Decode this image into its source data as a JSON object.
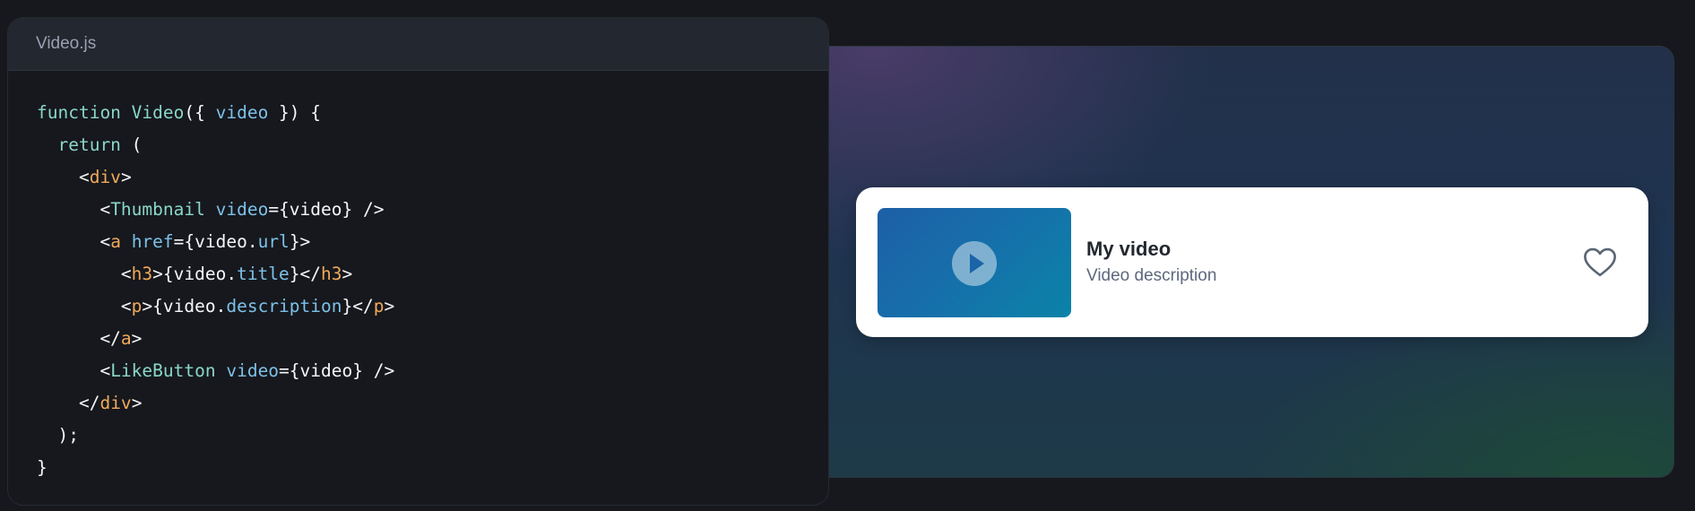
{
  "editor": {
    "filename": "Video.js",
    "lines": [
      [
        [
          "k",
          "function "
        ],
        [
          "k",
          "Video"
        ],
        [
          "p",
          "({ "
        ],
        [
          "v",
          "video"
        ],
        [
          "p",
          " }) {"
        ]
      ],
      [
        [
          "p",
          "  "
        ],
        [
          "k",
          "return"
        ],
        [
          "p",
          " ("
        ]
      ],
      [
        [
          "p",
          "    <"
        ],
        [
          "t",
          "div"
        ],
        [
          "p",
          ">"
        ]
      ],
      [
        [
          "p",
          "      <"
        ],
        [
          "c",
          "Thumbnail"
        ],
        [
          "p",
          " "
        ],
        [
          "v",
          "video"
        ],
        [
          "p",
          "={video} />"
        ]
      ],
      [
        [
          "p",
          "      <"
        ],
        [
          "t",
          "a"
        ],
        [
          "p",
          " "
        ],
        [
          "v",
          "href"
        ],
        [
          "p",
          "={video."
        ],
        [
          "v",
          "url"
        ],
        [
          "p",
          "}>"
        ]
      ],
      [
        [
          "p",
          "        <"
        ],
        [
          "t",
          "h3"
        ],
        [
          "p",
          ">{video."
        ],
        [
          "v",
          "title"
        ],
        [
          "p",
          "}</"
        ],
        [
          "t",
          "h3"
        ],
        [
          "p",
          ">"
        ]
      ],
      [
        [
          "p",
          "        <"
        ],
        [
          "t",
          "p"
        ],
        [
          "p",
          ">{video."
        ],
        [
          "v",
          "description"
        ],
        [
          "p",
          "}</"
        ],
        [
          "t",
          "p"
        ],
        [
          "p",
          ">"
        ]
      ],
      [
        [
          "p",
          "      </"
        ],
        [
          "t",
          "a"
        ],
        [
          "p",
          ">"
        ]
      ],
      [
        [
          "p",
          "      <"
        ],
        [
          "c",
          "LikeButton"
        ],
        [
          "p",
          " "
        ],
        [
          "v",
          "video"
        ],
        [
          "p",
          "={video} />"
        ]
      ],
      [
        [
          "p",
          "    </"
        ],
        [
          "t",
          "div"
        ],
        [
          "p",
          ">"
        ]
      ],
      [
        [
          "p",
          "  );"
        ]
      ],
      [
        [
          "p",
          "}"
        ]
      ]
    ]
  },
  "preview": {
    "video_title": "My video",
    "video_description": "Video description",
    "icons": {
      "play": "play-icon",
      "like": "heart-icon"
    }
  }
}
